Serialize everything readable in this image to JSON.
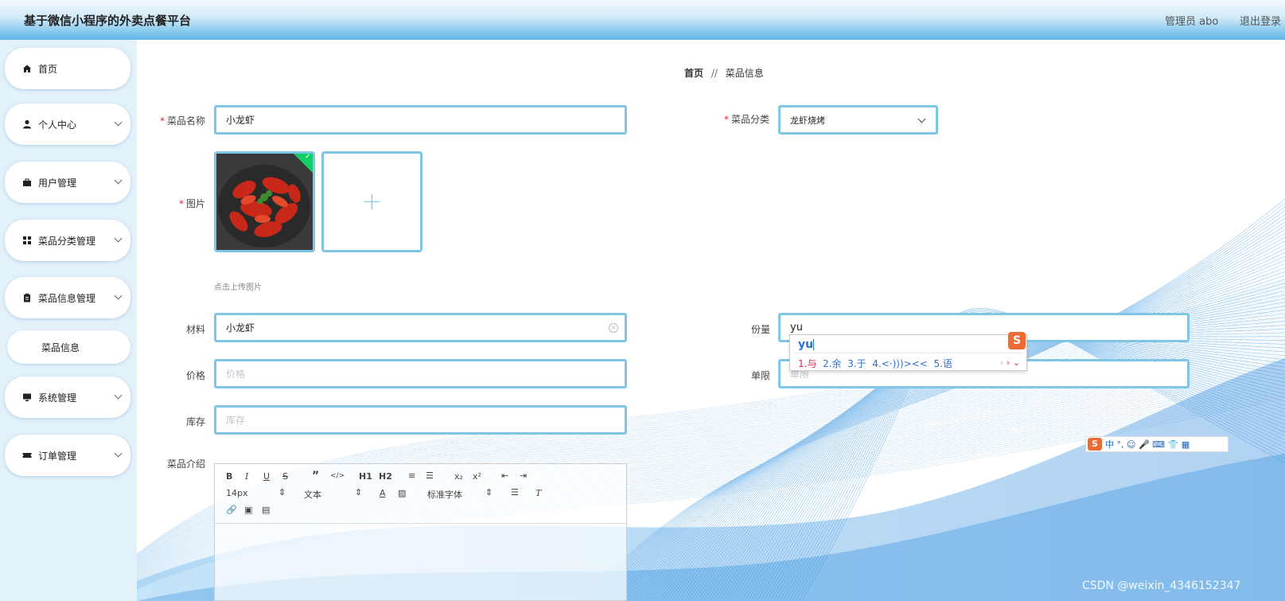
{
  "header": {
    "title": "基于微信小程序的外卖点餐平台",
    "user": "管理员 abo",
    "logout": "退出登录"
  },
  "sidebar": {
    "items": [
      {
        "label": "首页",
        "icon": "home-icon"
      },
      {
        "label": "个人中心",
        "icon": "user-icon"
      },
      {
        "label": "用户管理",
        "icon": "briefcase-icon"
      },
      {
        "label": "菜品分类管理",
        "icon": "grid-icon"
      },
      {
        "label": "菜品信息管理",
        "icon": "clipboard-icon"
      },
      {
        "label": "系统管理",
        "icon": "monitor-icon"
      },
      {
        "label": "订单管理",
        "icon": "ticket-icon"
      }
    ],
    "submenu": {
      "label": "菜品信息"
    }
  },
  "breadcrumb": {
    "home": "首页",
    "sep": "//",
    "current": "菜品信息"
  },
  "form": {
    "name": {
      "label": "菜品名称",
      "value": "小龙虾"
    },
    "category": {
      "label": "菜品分类",
      "value": "龙虾烧烤"
    },
    "image": {
      "label": "图片",
      "tip": "点击上传图片"
    },
    "material": {
      "label": "材料",
      "value": "小龙虾"
    },
    "portion": {
      "label": "份量",
      "value": "yu"
    },
    "price": {
      "label": "价格",
      "placeholder": "价格"
    },
    "limit": {
      "label": "单限",
      "placeholder": "单限"
    },
    "stock": {
      "label": "库存",
      "placeholder": "库存"
    },
    "intro": {
      "label": "菜品介绍"
    }
  },
  "editor": {
    "row1": [
      "B",
      "I",
      "U",
      "S",
      "”",
      "</>",
      "H1",
      "H2",
      "≡",
      "☰",
      "x₂",
      "x²",
      "⇤",
      "⇥"
    ],
    "font_size": "14px",
    "text_type": "文本",
    "font_family": "标准字体"
  },
  "ime": {
    "pinyin": "yu",
    "candidates": [
      "1.与",
      "2.余",
      "3.于",
      "4.<·)))><<",
      "5.语"
    ],
    "toolbar_text": "中 °, ☺ 🎤 ⌨ 👕 ▦"
  },
  "watermark": "CSDN @weixin_4346152347"
}
